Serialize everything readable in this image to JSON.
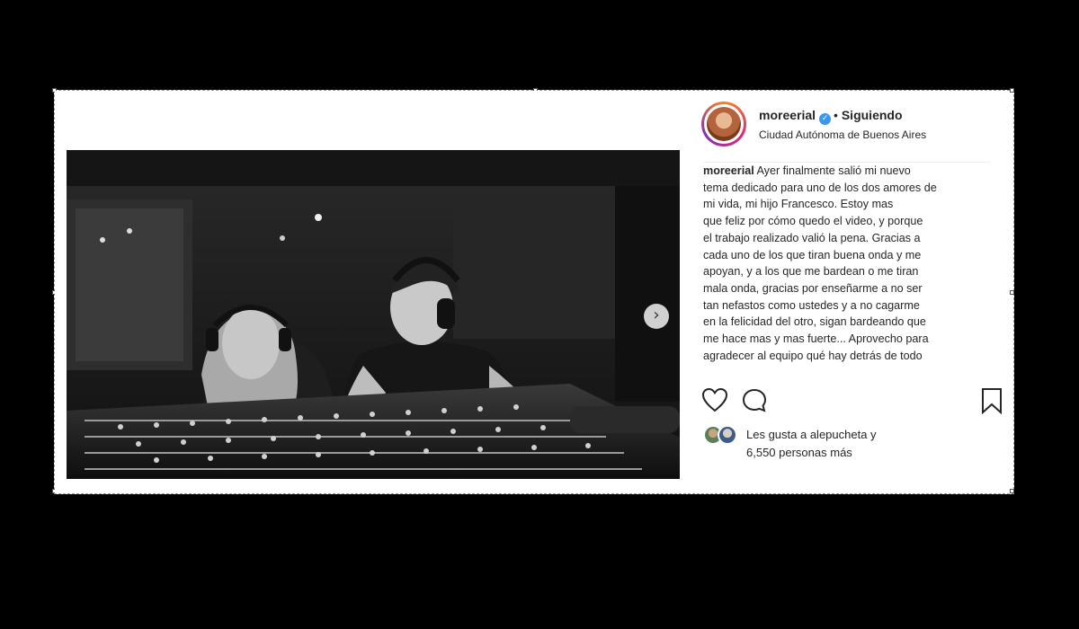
{
  "post": {
    "username": "moreerial",
    "separator": "•",
    "follow_status": "Siguiendo",
    "location": "Ciudad Autónoma de Buenos Aires",
    "caption_user": "moreerial",
    "caption_text": " Ayer finalmente salió mi nuevo\ntema dedicado para uno de los dos amores de\nmi vida, mi hijo Francesco. Estoy mas\nque feliz por cómo quedo el video, y porque\nel trabajo realizado valió la pena. Gracias a\ncada uno de los que tiran buena onda y me\napoyan, y a los que me bardean o me tiran\nmala onda, gracias por enseñarme a no ser\ntan nefastos como ustedes y a no cagarme\nen la felicidad del otro, sigan bardeando que\nme hace mas y mas fuerte... Aprovecho para\nagradecer al equipo qué hay detrás de todo",
    "likes_text": "Les gusta a alepucheta y\n6,550 personas más"
  },
  "icons": {
    "next": "chevron-right-icon",
    "tag": "user-tag-icon",
    "like": "heart-icon",
    "comment": "comment-icon",
    "save": "bookmark-icon",
    "verified": "verified-badge-icon"
  },
  "colors": {
    "verified": "#3897f0",
    "text": "#262626",
    "background": "#000000"
  }
}
